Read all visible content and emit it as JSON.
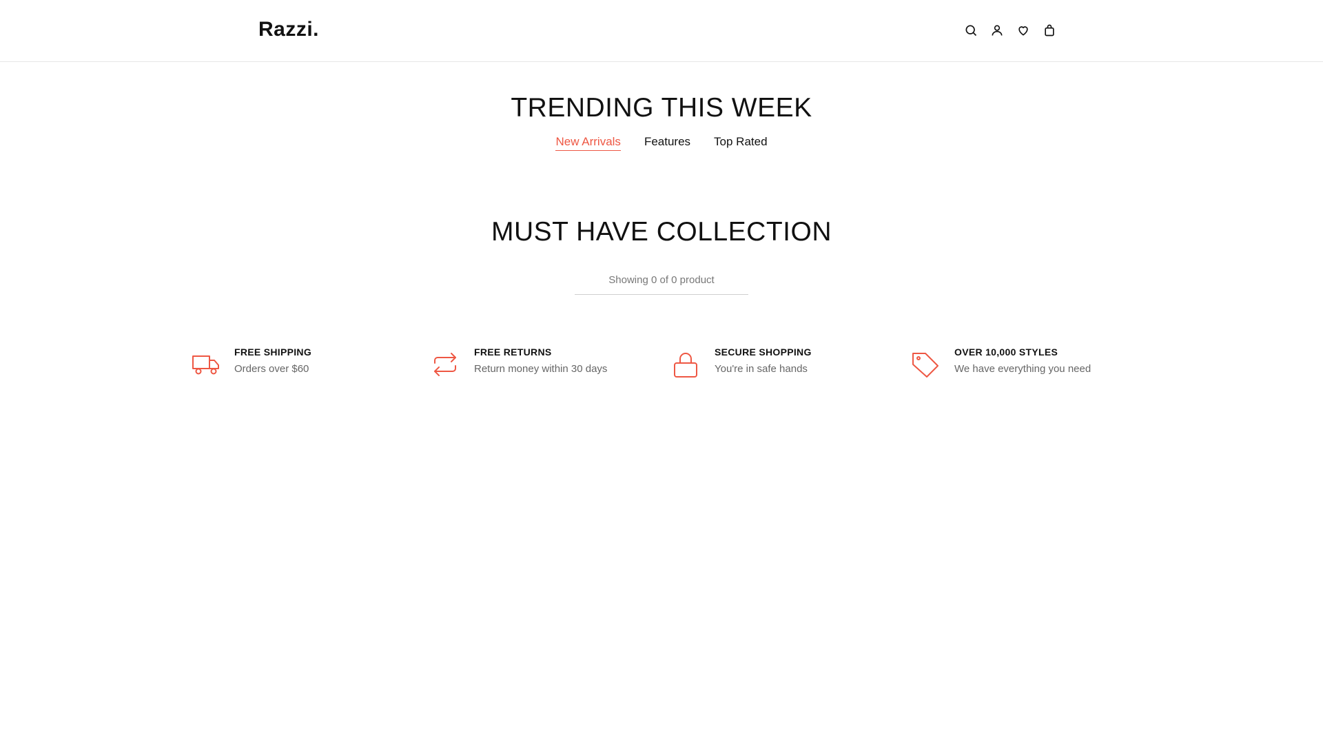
{
  "header": {
    "logo": "Razzi.",
    "icons": [
      "search-icon",
      "user-icon",
      "heart-icon",
      "bag-icon"
    ]
  },
  "trending": {
    "title": "TRENDING THIS WEEK",
    "tabs": [
      {
        "label": "New Arrivals",
        "active": true
      },
      {
        "label": "Features",
        "active": false
      },
      {
        "label": "Top Rated",
        "active": false
      }
    ]
  },
  "collection": {
    "title": "MUST HAVE COLLECTION",
    "showing": "Showing 0 of 0 product"
  },
  "features": [
    {
      "icon": "truck-icon",
      "title": "FREE SHIPPING",
      "desc": "Orders over $60"
    },
    {
      "icon": "returns-icon",
      "title": "FREE RETURNS",
      "desc": "Return money within 30 days"
    },
    {
      "icon": "lock-icon",
      "title": "SECURE SHOPPING",
      "desc": "You're in safe hands"
    },
    {
      "icon": "tag-icon",
      "title": "OVER 10,000 STYLES",
      "desc": "We have everything you need"
    }
  ],
  "colors": {
    "accent": "#ee5743",
    "text": "#111111",
    "muted": "#777777"
  }
}
